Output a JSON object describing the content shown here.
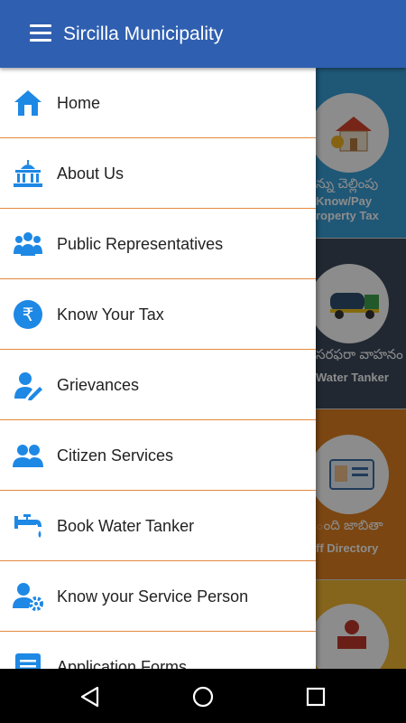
{
  "app": {
    "title": "Sircilla Municipality"
  },
  "drawer": {
    "items": [
      {
        "label": "Home",
        "icon": "home-icon"
      },
      {
        "label": "About Us",
        "icon": "building-icon"
      },
      {
        "label": "Public Representatives",
        "icon": "people-group-icon"
      },
      {
        "label": "Know Your Tax",
        "icon": "rupee-icon"
      },
      {
        "label": "Grievances",
        "icon": "user-edit-icon"
      },
      {
        "label": "Citizen Services",
        "icon": "two-users-icon"
      },
      {
        "label": "Book Water Tanker",
        "icon": "water-tap-icon"
      },
      {
        "label": "Know your Service Person",
        "icon": "user-gear-icon"
      },
      {
        "label": "Application Forms",
        "icon": "form-icon"
      }
    ]
  },
  "background_tiles": [
    {
      "telugu": "న్ను చెల్లింపు",
      "english_line1": "Know/Pay",
      "english_line2": "roperty Tax",
      "color": "#3a9fd8",
      "icon": "house-icon"
    },
    {
      "telugu": "సరఫరా వాహనం",
      "english_line1": "Water Tanker",
      "english_line2": "",
      "color": "#3d4a5c",
      "icon": "tanker-truck-icon"
    },
    {
      "telugu": "ంది జాబితా",
      "english_line1": "ff Directory",
      "english_line2": "",
      "color": "#e08020",
      "icon": "id-card-icon"
    },
    {
      "telugu": "",
      "english_line1": "",
      "english_line2": "",
      "color": "#f2b632",
      "icon": "counter-person-icon"
    }
  ],
  "colors": {
    "appbar": "#2f5fb0",
    "icon_blue": "#1e88e5",
    "divider": "#e5893e"
  },
  "navigation_bar": {
    "buttons": [
      "back-icon",
      "home-circle-icon",
      "recents-icon"
    ]
  }
}
